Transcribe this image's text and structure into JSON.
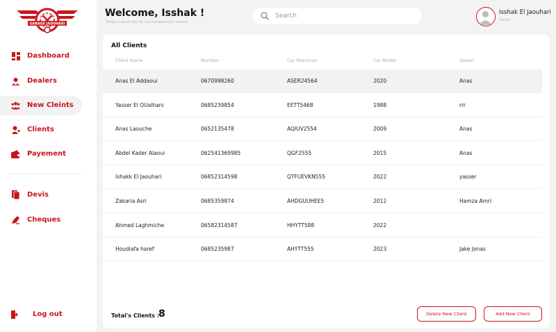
{
  "brand": {
    "logo_text": "GARAGE JAOUHARI",
    "accent_color": "#c8161d"
  },
  "sidebar": {
    "items": [
      {
        "label": "Dashboard",
        "icon": "dashboard-icon",
        "active": false
      },
      {
        "label": "Dealers",
        "icon": "dealers-icon",
        "active": false
      },
      {
        "label": "New Cleints",
        "icon": "new-clients-icon",
        "active": true
      },
      {
        "label": "Clients",
        "icon": "clients-icon",
        "active": false
      },
      {
        "label": "Payement",
        "icon": "payment-icon",
        "active": false
      },
      {
        "label": "Devis",
        "icon": "devis-icon",
        "active": false
      },
      {
        "label": "Cheques",
        "icon": "cheques-icon",
        "active": false
      }
    ],
    "logout_label": "Log out"
  },
  "header": {
    "welcome": "Welcome, Isshak !",
    "subtitle": "Today is great day for car management service",
    "search_placeholder": "Search",
    "user_name": "Isshak El Jaouhari",
    "user_role": "Owner"
  },
  "clients": {
    "title": "All Clients",
    "columns": [
      "Client Name",
      "Number",
      "Car Matricule",
      "Car Model",
      "Dealer"
    ],
    "rows": [
      [
        "Anas El Addaoui",
        "0670998260",
        "ASER24564",
        "2020",
        "Anas"
      ],
      [
        "Yasser El OUalhani",
        "0685239854",
        "EETT5468",
        "1988",
        "rrr"
      ],
      [
        "Anas Laouche",
        "0652135478",
        "AQIUV2554",
        "2009",
        "Anas"
      ],
      [
        "Abdel Kader Alaoui",
        "062541369985",
        "QGF2555",
        "2015",
        "Anas"
      ],
      [
        "Ishakk El Jaouhari",
        "06852314598",
        "QTFUEVKN555",
        "2022",
        "yasser"
      ],
      [
        "Zakaria Asri",
        "0685359874",
        "AHDGUUHEE5",
        "2012",
        "Hamza Amri"
      ],
      [
        "Ahmed Laghmiche",
        "06582314587",
        "HHYTT588",
        "2022",
        ""
      ],
      [
        "Houdiafa haref",
        "0685235987",
        "AHYTT555",
        "2023",
        "Jake Jonas"
      ]
    ],
    "total_label": "Total's Clients :",
    "total_value": "8",
    "delete_button": "Delete New Client",
    "add_button": "Add New Client"
  }
}
